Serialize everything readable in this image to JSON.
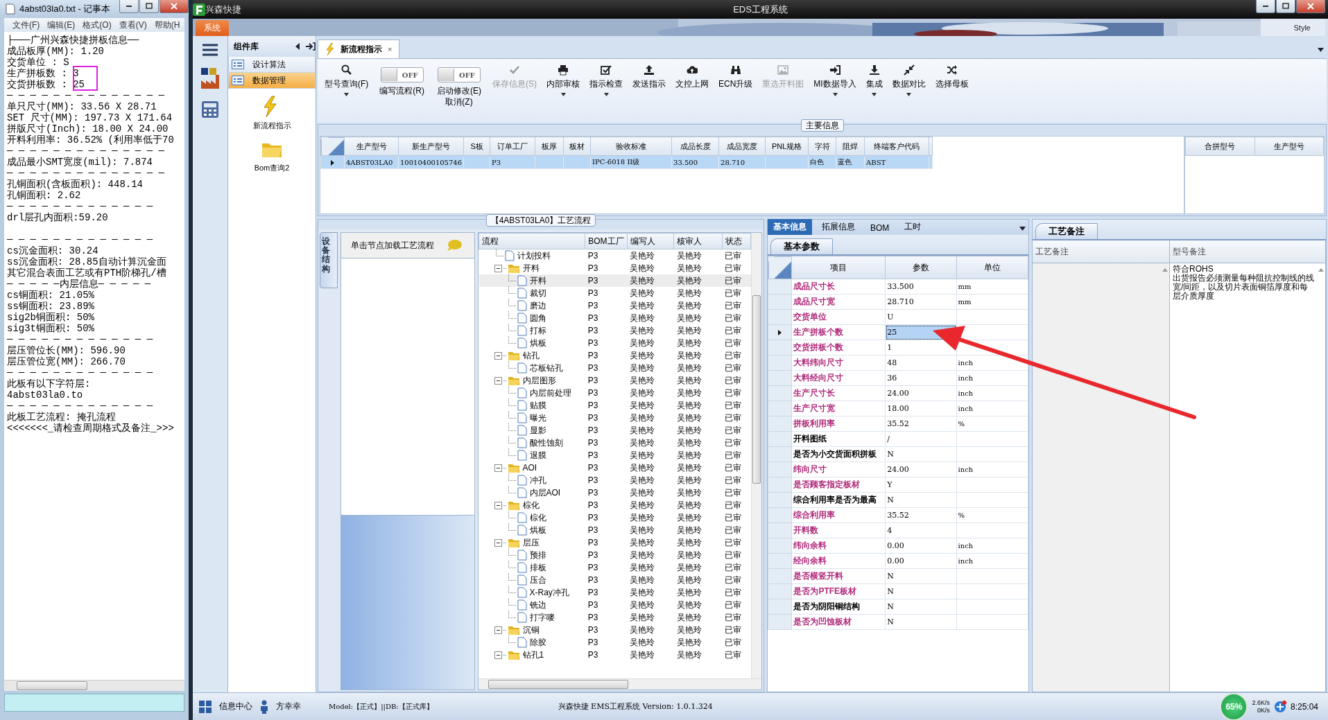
{
  "notepad": {
    "title": "4abst03la0.txt - 记事本",
    "menu": [
      "文件(F)",
      "编辑(E)",
      "格式(O)",
      "查看(V)",
      "帮助(H"
    ],
    "lines": [
      {
        "text": "├───广州兴森快捷拼板信息──",
        "marked": false
      },
      {
        "text": "成品板厚(MM): 1.20",
        "marked": false
      },
      {
        "text": "交货单位 : S",
        "marked": false
      },
      {
        "text": "生产拼板数 : 3",
        "marked": true
      },
      {
        "text": "交货拼板数 : 25",
        "marked": true
      },
      {
        "text": "─ ─ ─ ─ ─ ─ ─ ─ ─ ─ ─ ─ ─ ─",
        "marked": false
      },
      {
        "text": "单只尺寸(MM): 33.56 X 28.71",
        "marked": false
      },
      {
        "text": "SET 尺寸(MM): 197.73 X 171.64",
        "marked": false
      },
      {
        "text": "拼版尺寸(Inch): 18.00 X 24.00",
        "marked": false
      },
      {
        "text": "开料利用率: 36.52% (利用率低于70",
        "marked": false
      },
      {
        "text": "─ ─ ─ ─ ─ ─ ─ ─ ─ ─ ─ ─ ─ ─",
        "marked": false
      },
      {
        "text": "成品最小SMT宽度(mil): 7.874",
        "marked": false
      },
      {
        "text": "─ ─ ─ ─ ─ ─ ─ ─ ─ ─ ─ ─ ─ ─",
        "marked": false
      },
      {
        "text": "孔铜面积(含板面积): 448.14",
        "marked": false
      },
      {
        "text": "孔铜面积: 2.62",
        "marked": false
      },
      {
        "text": "─ ─ ─ ─ ─ ─ ─ ─ ─ ─ ─ ─ ─",
        "marked": false
      },
      {
        "text": "drl层孔内面积:59.20",
        "marked": false
      },
      {
        "marked": false
      },
      {
        "text": "─ ─ ─ ─ ─ ─ ─ ─ ─ ─ ─ ─ ─",
        "marked": false
      },
      {
        "text": "cs沉金面积: 30.24",
        "marked": false
      },
      {
        "text": "ss沉金面积: 28.85自动计算沉金面",
        "marked": false
      },
      {
        "text": "其它混合表面工艺或有PTH阶梯孔/槽",
        "marked": false
      },
      {
        "text": "─ ─ ─ ─ ─内层信息─ ─ ─ ─ ─",
        "marked": false
      },
      {
        "text": "cs铜面积: 21.05%",
        "marked": false
      },
      {
        "text": "ss铜面积: 23.89%",
        "marked": false
      },
      {
        "text": "sig2b铜面积: 50%",
        "marked": false
      },
      {
        "text": "sig3t铜面积: 50%",
        "marked": false
      },
      {
        "text": "─ ─ ─ ─ ─ ─ ─ ─ ─ ─ ─ ─ ─",
        "marked": false
      },
      {
        "text": "层压管位长(MM): 596.90",
        "marked": false
      },
      {
        "text": "层压管位宽(MM): 266.70",
        "marked": false
      },
      {
        "text": "─ ─ ─ ─ ─ ─ ─ ─ ─ ─ ─ ─ ─",
        "marked": false
      },
      {
        "text": "此板有以下字符层:",
        "marked": false
      },
      {
        "text": "4abst03la0.to",
        "marked": false
      },
      {
        "text": "─ ─ ─ ─ ─ ─ ─ ─ ─ ─ ─ ─ ─",
        "marked": false
      },
      {
        "text": "此板工艺流程: 掩孔流程",
        "marked": false
      },
      {
        "text": "<<<<<<<_请检查周期格式及备注_>>>",
        "marked": false
      }
    ]
  },
  "app": {
    "title": "兴森快捷",
    "caption": "EDS工程系统",
    "system_tab": "系统",
    "style_label": "Style"
  },
  "component_panel": {
    "title": "组件库",
    "items": [
      {
        "label": "设计算法",
        "selected": false
      },
      {
        "label": "数据管理",
        "selected": true
      }
    ],
    "tiles": [
      {
        "label": "新流程指示"
      },
      {
        "label": "Bom查询2"
      }
    ]
  },
  "doc_tabs": [
    {
      "label": "新流程指示",
      "selected": true,
      "close_symbol": "×"
    }
  ],
  "toolbar": [
    {
      "kind": "button",
      "label": "型号查询(F)",
      "dropdown": true,
      "disabled": false
    },
    {
      "kind": "toggle",
      "state_text": "OFF",
      "on": false,
      "label": "编写流程(R)"
    },
    {
      "kind": "toggle",
      "state_text": "OFF",
      "on": false,
      "label": "启动修改(E)",
      "sublabel": "取消(Z)"
    },
    {
      "kind": "button",
      "label": "保存信息(S)",
      "dropdown": false,
      "disabled": true
    },
    {
      "kind": "button",
      "label": "内部审核",
      "dropdown": true,
      "disabled": false
    },
    {
      "kind": "button",
      "label": "指示检查",
      "dropdown": true,
      "disabled": false
    },
    {
      "kind": "button",
      "label": "发送指示",
      "dropdown": false,
      "disabled": false
    },
    {
      "kind": "button",
      "label": "文控上网",
      "dropdown": false,
      "disabled": false
    },
    {
      "kind": "button",
      "label": "ECN升级",
      "dropdown": false,
      "disabled": false
    },
    {
      "kind": "button",
      "label": "重选开料图",
      "dropdown": false,
      "disabled": true
    },
    {
      "kind": "button",
      "label": "MI数据导入",
      "dropdown": true,
      "disabled": false
    },
    {
      "kind": "button",
      "label": "集成",
      "dropdown": true,
      "disabled": false
    },
    {
      "kind": "button",
      "label": "数据对比",
      "dropdown": true,
      "disabled": false
    },
    {
      "kind": "button",
      "label": "选择母板",
      "dropdown": false,
      "disabled": false
    }
  ],
  "main_info": {
    "legend": "主要信息",
    "columns": [
      "生产型号",
      "新生产型号",
      "S板",
      "订单工厂",
      "板厚",
      "板材",
      "验收标准",
      "成品长度",
      "成品宽度",
      "PNL规格",
      "字符",
      "阻焊",
      "终端客户代码"
    ],
    "rows": [
      {
        "selected": true,
        "cells": [
          "4ABST03LA0",
          "10010400105746",
          null,
          "P3",
          null,
          null,
          "IPC-6018 II级",
          "33.500",
          "28.710",
          null,
          "白色",
          "蓝色",
          "ABST"
        ]
      }
    ],
    "side_columns": [
      "合拼型号",
      "生产型号"
    ]
  },
  "process": {
    "legend": "【4ABST03LA0】工艺流程",
    "side_tab": "设备结构",
    "hint": "单击节点加载工艺流程",
    "columns": [
      "流程",
      "BOM工厂",
      "编写人",
      "核审人",
      "状态"
    ],
    "nodes": [
      {
        "kind": "file",
        "label": "计划投料",
        "factory": "P3",
        "writer": "吴艳玲",
        "reviewer": "吴艳玲",
        "status": "已审",
        "selected": false
      },
      {
        "kind": "folder",
        "label": "开料",
        "factory": "P3",
        "writer": "吴艳玲",
        "reviewer": "吴艳玲",
        "status": "已审",
        "selected": false,
        "expanded": true,
        "children": [
          {
            "kind": "file",
            "label": "开料",
            "factory": "P3",
            "writer": "吴艳玲",
            "reviewer": "吴艳玲",
            "status": "已审",
            "selected": true
          },
          {
            "kind": "file",
            "label": "裁切",
            "factory": "P3",
            "writer": "吴艳玲",
            "reviewer": "吴艳玲",
            "status": "已审",
            "selected": false
          },
          {
            "kind": "file",
            "label": "磨边",
            "factory": "P3",
            "writer": "吴艳玲",
            "reviewer": "吴艳玲",
            "status": "已审",
            "selected": false
          },
          {
            "kind": "file",
            "label": "圆角",
            "factory": "P3",
            "writer": "吴艳玲",
            "reviewer": "吴艳玲",
            "status": "已审",
            "selected": false
          },
          {
            "kind": "file",
            "label": "打标",
            "factory": "P3",
            "writer": "吴艳玲",
            "reviewer": "吴艳玲",
            "status": "已审",
            "selected": false
          },
          {
            "kind": "file",
            "label": "烘板",
            "factory": "P3",
            "writer": "吴艳玲",
            "reviewer": "吴艳玲",
            "status": "已审",
            "selected": false
          }
        ]
      },
      {
        "kind": "folder",
        "label": "钻孔",
        "factory": "P3",
        "writer": "吴艳玲",
        "reviewer": "吴艳玲",
        "status": "已审",
        "selected": false,
        "expanded": true,
        "children": [
          {
            "kind": "file",
            "label": "芯板钻孔",
            "factory": "P3",
            "writer": "吴艳玲",
            "reviewer": "吴艳玲",
            "status": "已审",
            "selected": false
          }
        ]
      },
      {
        "kind": "folder",
        "label": "内层图形",
        "factory": "P3",
        "writer": "吴艳玲",
        "reviewer": "吴艳玲",
        "status": "已审",
        "selected": false,
        "expanded": true,
        "children": [
          {
            "kind": "file",
            "label": "内层前处理",
            "factory": "P3",
            "writer": "吴艳玲",
            "reviewer": "吴艳玲",
            "status": "已审",
            "selected": false
          },
          {
            "kind": "file",
            "label": "贴膜",
            "factory": "P3",
            "writer": "吴艳玲",
            "reviewer": "吴艳玲",
            "status": "已审",
            "selected": false
          },
          {
            "kind": "file",
            "label": "曝光",
            "factory": "P3",
            "writer": "吴艳玲",
            "reviewer": "吴艳玲",
            "status": "已审",
            "selected": false
          },
          {
            "kind": "file",
            "label": "显影",
            "factory": "P3",
            "writer": "吴艳玲",
            "reviewer": "吴艳玲",
            "status": "已审",
            "selected": false
          },
          {
            "kind": "file",
            "label": "酸性蚀刻",
            "factory": "P3",
            "writer": "吴艳玲",
            "reviewer": "吴艳玲",
            "status": "已审",
            "selected": false
          },
          {
            "kind": "file",
            "label": "退膜",
            "factory": "P3",
            "writer": "吴艳玲",
            "reviewer": "吴艳玲",
            "status": "已审",
            "selected": false
          }
        ]
      },
      {
        "kind": "folder",
        "label": "AOI",
        "factory": "P3",
        "writer": "吴艳玲",
        "reviewer": "吴艳玲",
        "status": "已审",
        "selected": false,
        "expanded": true,
        "children": [
          {
            "kind": "file",
            "label": "冲孔",
            "factory": "P3",
            "writer": "吴艳玲",
            "reviewer": "吴艳玲",
            "status": "已审",
            "selected": false
          },
          {
            "kind": "file",
            "label": "内层AOI",
            "factory": "P3",
            "writer": "吴艳玲",
            "reviewer": "吴艳玲",
            "status": "已审",
            "selected": false
          }
        ]
      },
      {
        "kind": "folder",
        "label": "棕化",
        "factory": "P3",
        "writer": "吴艳玲",
        "reviewer": "吴艳玲",
        "status": "已审",
        "selected": false,
        "expanded": true,
        "children": [
          {
            "kind": "file",
            "label": "棕化",
            "factory": "P3",
            "writer": "吴艳玲",
            "reviewer": "吴艳玲",
            "status": "已审",
            "selected": false
          },
          {
            "kind": "file",
            "label": "烘板",
            "factory": "P3",
            "writer": "吴艳玲",
            "reviewer": "吴艳玲",
            "status": "已审",
            "selected": false
          }
        ]
      },
      {
        "kind": "folder",
        "label": "层压",
        "factory": "P3",
        "writer": "吴艳玲",
        "reviewer": "吴艳玲",
        "status": "已审",
        "selected": false,
        "expanded": true,
        "children": [
          {
            "kind": "file",
            "label": "预排",
            "factory": "P3",
            "writer": "吴艳玲",
            "reviewer": "吴艳玲",
            "status": "已审",
            "selected": false
          },
          {
            "kind": "file",
            "label": "排板",
            "factory": "P3",
            "writer": "吴艳玲",
            "reviewer": "吴艳玲",
            "status": "已审",
            "selected": false
          },
          {
            "kind": "file",
            "label": "压合",
            "factory": "P3",
            "writer": "吴艳玲",
            "reviewer": "吴艳玲",
            "status": "已审",
            "selected": false
          },
          {
            "kind": "file",
            "label": "X-Ray冲孔",
            "factory": "P3",
            "writer": "吴艳玲",
            "reviewer": "吴艳玲",
            "status": "已审",
            "selected": false
          },
          {
            "kind": "file",
            "label": "铣边",
            "factory": "P3",
            "writer": "吴艳玲",
            "reviewer": "吴艳玲",
            "status": "已审",
            "selected": false
          },
          {
            "kind": "file",
            "label": "打字嘜",
            "factory": "P3",
            "writer": "吴艳玲",
            "reviewer": "吴艳玲",
            "status": "已审",
            "selected": false
          }
        ]
      },
      {
        "kind": "folder",
        "label": "沉铜",
        "factory": "P3",
        "writer": "吴艳玲",
        "reviewer": "吴艳玲",
        "status": "已审",
        "selected": false,
        "expanded": true,
        "children": [
          {
            "kind": "file",
            "label": "除胶",
            "factory": "P3",
            "writer": "吴艳玲",
            "reviewer": "吴艳玲",
            "status": "已审",
            "selected": false
          }
        ]
      },
      {
        "kind": "folder",
        "label": "钻孔1",
        "factory": "P3",
        "writer": "吴艳玲",
        "reviewer": "吴艳玲",
        "status": "已审",
        "selected": false,
        "expanded": true
      }
    ]
  },
  "params": {
    "tabs": [
      {
        "label": "基本信息",
        "selected": true
      },
      {
        "label": "拓展信息",
        "selected": false
      },
      {
        "label": "BOM",
        "selected": false
      },
      {
        "label": "工时",
        "selected": false
      }
    ],
    "subtab": "基本参数",
    "columns": [
      "项目",
      "参数",
      "单位"
    ],
    "rows": [
      {
        "item": "成品尺寸长",
        "value": "33.500",
        "unit": "mm",
        "color": "#b0287a",
        "selected": false
      },
      {
        "item": "成品尺寸宽",
        "value": "28.710",
        "unit": "mm",
        "color": "#b0287a",
        "selected": false
      },
      {
        "item": "交货单位",
        "value": "U",
        "color": "#b0287a",
        "selected": false
      },
      {
        "item": "生产拼板个数",
        "value": "25",
        "color": "#b0287a",
        "selected": true
      },
      {
        "item": "交货拼板个数",
        "value": "1",
        "color": "#b0287a",
        "selected": false
      },
      {
        "item": "大料纬向尺寸",
        "value": "48",
        "unit": "inch",
        "color": "#b0287a",
        "selected": false
      },
      {
        "item": "大料经向尺寸",
        "value": "36",
        "unit": "inch",
        "color": "#b0287a",
        "selected": false
      },
      {
        "item": "生产尺寸长",
        "value": "24.00",
        "unit": "inch",
        "color": "#b0287a",
        "selected": false
      },
      {
        "item": "生产尺寸宽",
        "value": "18.00",
        "unit": "inch",
        "color": "#b0287a",
        "selected": false
      },
      {
        "item": "拼板利用率",
        "value": "35.52",
        "unit": "%",
        "color": "#b0287a",
        "selected": false
      },
      {
        "item": "开料图纸",
        "value": "/",
        "color": "#000000",
        "selected": false
      },
      {
        "item": "是否为小交货面积拼板",
        "value": "N",
        "color": "#000000",
        "selected": false
      },
      {
        "item": "纬向尺寸",
        "value": "24.00",
        "unit": "inch",
        "color": "#b0287a",
        "selected": false
      },
      {
        "item": "是否顾客指定板材",
        "value": "Y",
        "color": "#b0287a",
        "selected": false
      },
      {
        "item": "综合利用率是否为最高",
        "value": "N",
        "color": "#000000",
        "selected": false
      },
      {
        "item": "综合利用率",
        "value": "35.52",
        "unit": "%",
        "color": "#b0287a",
        "selected": false
      },
      {
        "item": "开料数",
        "value": "4",
        "color": "#b0287a",
        "selected": false
      },
      {
        "item": "纬向余料",
        "value": "0.00",
        "unit": "inch",
        "color": "#b0287a",
        "selected": false
      },
      {
        "item": "经向余料",
        "value": "0.00",
        "unit": "inch",
        "color": "#b0287a",
        "selected": false
      },
      {
        "item": "是否横竖开料",
        "value": "N",
        "color": "#b0287a",
        "selected": false
      },
      {
        "item": "是否为PTFE板材",
        "value": "N",
        "color": "#b0287a",
        "selected": false
      },
      {
        "item": "是否为阴阳铜结构",
        "value": "N",
        "color": "#000000",
        "selected": false
      },
      {
        "item": "是否为凹蚀板材",
        "value": "N",
        "color": "#b0287a",
        "selected": false
      }
    ]
  },
  "remarks": {
    "tab": "工艺备注",
    "columns": [
      "工艺备注",
      "型号备注"
    ],
    "model_remarks": [
      "符合ROHS",
      "出货报告必须测量每种阻抗控制线的线宽/间距，以及切片表面铜箔厚度和每层介质厚度"
    ]
  },
  "status_bar": {
    "info_center": "信息中心",
    "user": "方幸幸",
    "model": "Model:【正式】||DB:【正式库】",
    "version": "兴森快捷 EMS工程系统 Version: 1.0.1.324",
    "cpu": "65%",
    "upload": "2.6K/s",
    "download": "0K/s",
    "time": "8:25:04"
  }
}
